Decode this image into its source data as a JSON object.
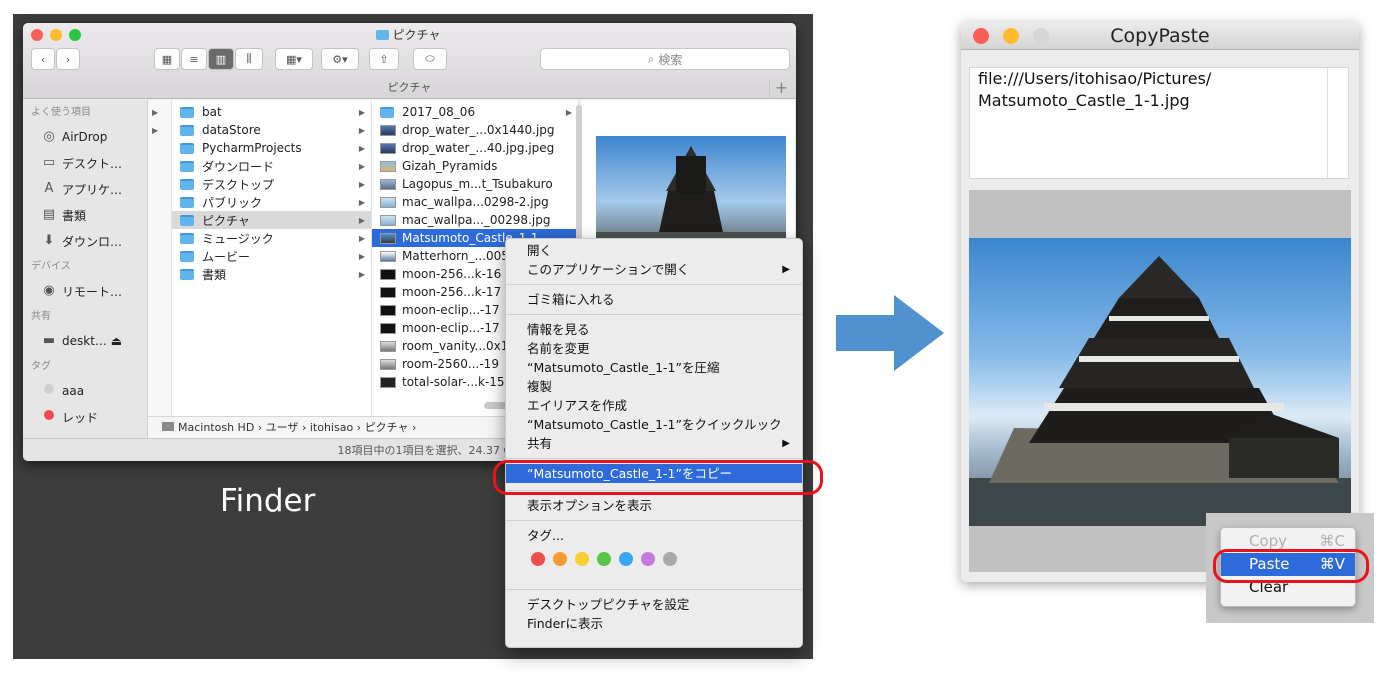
{
  "finder": {
    "window_title": "ピクチャ",
    "path_title": "ピクチャ",
    "search_placeholder": "検索",
    "plus": "+",
    "sidebar": {
      "favorites_header": "よく使う項目",
      "favorites": [
        {
          "label": "AirDrop",
          "icon": "airdrop-icon"
        },
        {
          "label": "デスクト…",
          "icon": "desktop-icon"
        },
        {
          "label": "アプリケ…",
          "icon": "applications-icon"
        },
        {
          "label": "書類",
          "icon": "documents-icon"
        },
        {
          "label": "ダウンロ…",
          "icon": "downloads-icon"
        }
      ],
      "devices_header": "デバイス",
      "devices": [
        {
          "label": "リモート…",
          "icon": "disc-icon"
        }
      ],
      "shared_header": "共有",
      "shared": [
        {
          "label": "deskt… ⏏",
          "icon": "computer-icon"
        }
      ],
      "tags_header": "タグ",
      "tags": [
        {
          "label": "aaa",
          "color": "#cfcfcf"
        },
        {
          "label": "レッド",
          "color": "#f24b4b"
        }
      ]
    },
    "column1": [
      "bat",
      "dataStore",
      "PycharmProjects",
      "ダウンロード",
      "デスクトップ",
      "パブリック",
      "ピクチャ",
      "ミュージック",
      "ムービー",
      "書類"
    ],
    "column2": [
      "2017_08_06",
      "drop_water_...0x1440.jpg",
      "drop_water_...40.jpg.jpeg",
      "Gizah_Pyramids",
      "Lagopus_m...t_Tsubakuro",
      "mac_wallpa...0298-2.jpg",
      "mac_wallpa..._00298.jpg",
      "Matsumoto_Castle_1-1",
      "Matterhorn_...005",
      "moon-256...k-16",
      "moon-256...k-17",
      "moon-eclip...-17",
      "moon-eclip...-17",
      "room_vanity...0x1",
      "room-2560...-19",
      "total-solar-...k-15"
    ],
    "pathbar": "Macintosh HD  ›  ユーザ  ›  itohisao  ›  ピクチャ  ›",
    "status": "18項目中の1項目を選択、24.37 GB空き"
  },
  "context_menu": {
    "items": [
      "開く",
      "このアプリケーションで開く",
      "ゴミ箱に入れる",
      "情報を見る",
      "名前を変更",
      "“Matsumoto_Castle_1-1”を圧縮",
      "複製",
      "エイリアスを作成",
      "“Matsumoto_Castle_1-1”をクイックルック",
      "共有",
      "“Matsumoto_Castle_1-1”をコピー",
      "表示オプションを表示",
      "タグ...",
      "デスクトップピクチャを設定",
      "Finderに表示"
    ],
    "submenu_arrow": "▶",
    "tag_colors": [
      "#f04e4a",
      "#f79a31",
      "#f5cf33",
      "#5ac449",
      "#39a6f2",
      "#c67ae0",
      "#a9a9a9"
    ]
  },
  "finder_label": "Finder",
  "copypaste": {
    "title": "CopyPaste",
    "text_line1": "file:///Users/itohisao/Pictures/",
    "text_line2": "Matsumoto_Castle_1-1.jpg",
    "menu": {
      "copy_label": "Copy",
      "copy_key": "⌘C",
      "paste_label": "Paste",
      "paste_key": "⌘V",
      "clear_label": "Clear"
    }
  },
  "colors": {
    "highlight": "#2c6bd9",
    "ring": "#e8131b",
    "arrow": "#4f92cf"
  }
}
